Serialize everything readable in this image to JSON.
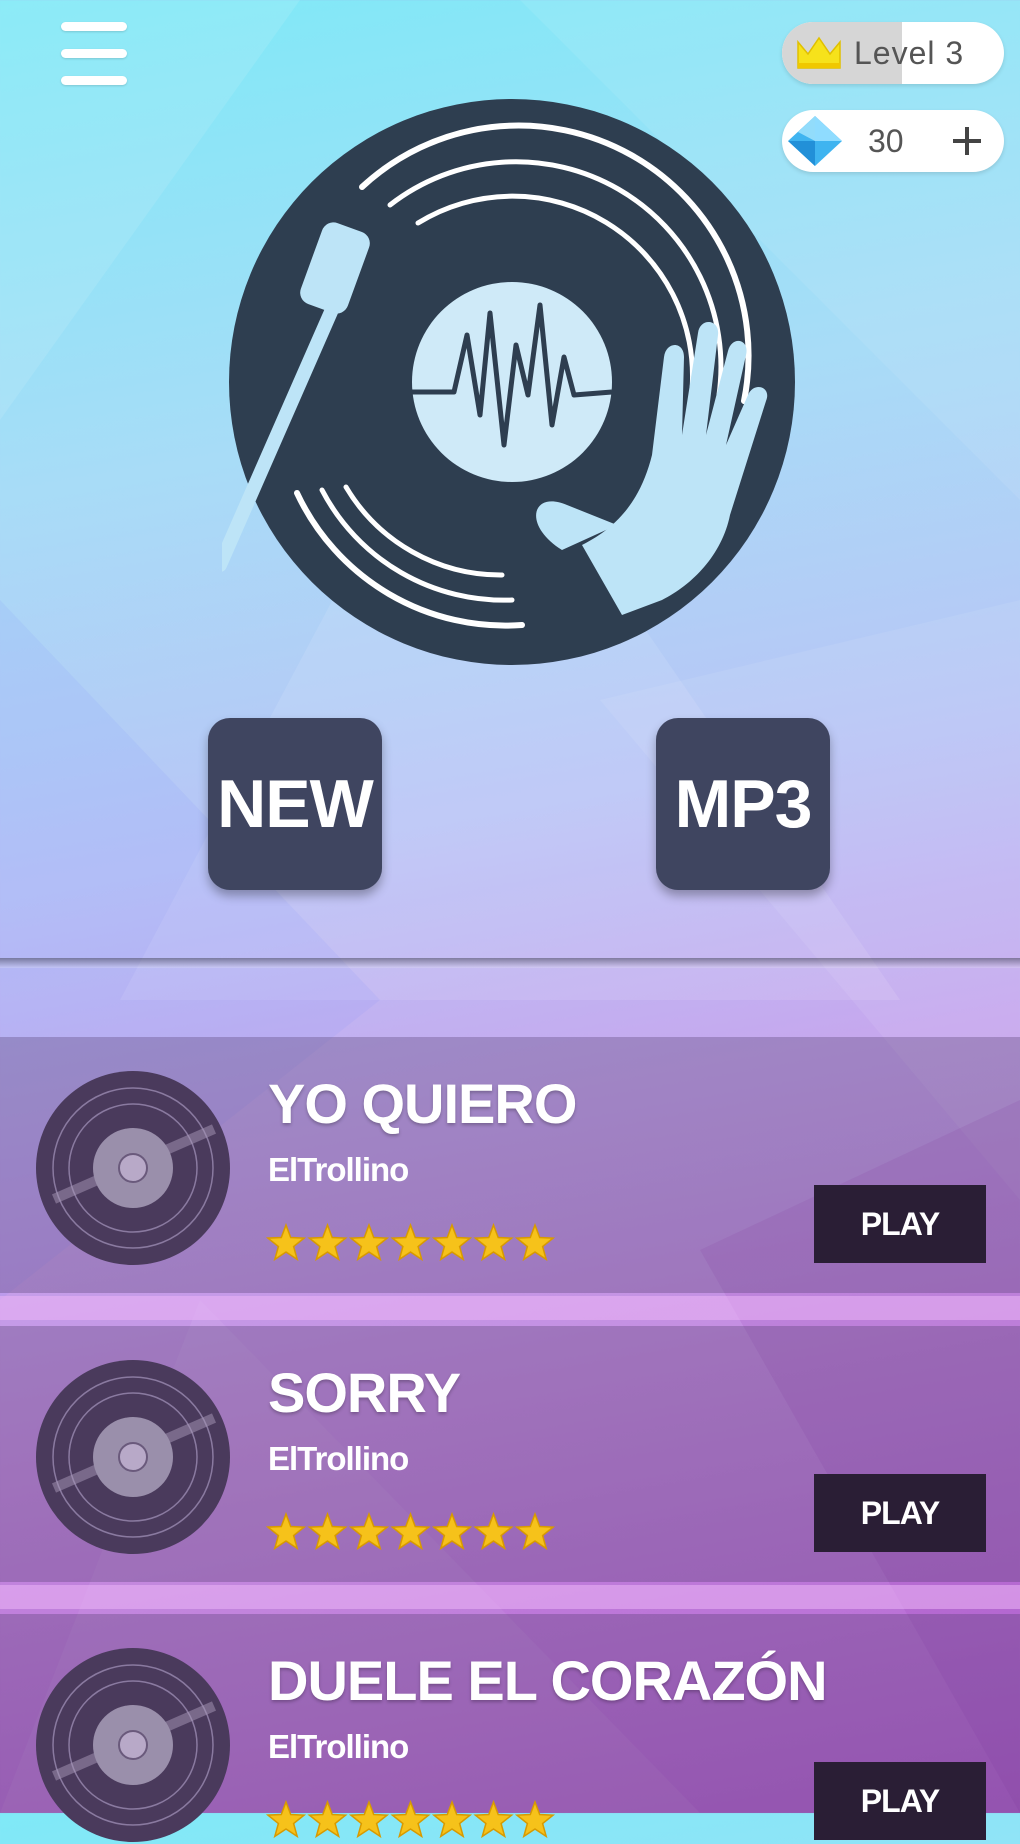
{
  "header": {
    "level_label": "Level 3",
    "level_progress": 0.54,
    "gems_count": "30"
  },
  "modes": {
    "new_label": "NEW",
    "mp3_label": "MP3"
  },
  "songs": [
    {
      "title": "YO QUIERO",
      "artist": "ElTrollino",
      "stars": 7,
      "play_label": "PLAY"
    },
    {
      "title": "SORRY",
      "artist": "ElTrollino",
      "stars": 7,
      "play_label": "PLAY"
    },
    {
      "title": "DUELE EL CORAZÓN",
      "artist": "ElTrollino",
      "stars": 7,
      "play_label": "PLAY"
    }
  ],
  "icons": {
    "menu": "hamburger-icon",
    "level": "crown-icon",
    "gems": "diamond-icon",
    "add": "plus-icon",
    "logo": "vinyl-turntable-logo",
    "song_disc": "vinyl-record-icon",
    "rating": "star-icon"
  },
  "colors": {
    "button_dark": "#3f4560",
    "play_button": "#2a1e35",
    "star": "#f6c21a",
    "logo": "#2e3e50"
  }
}
